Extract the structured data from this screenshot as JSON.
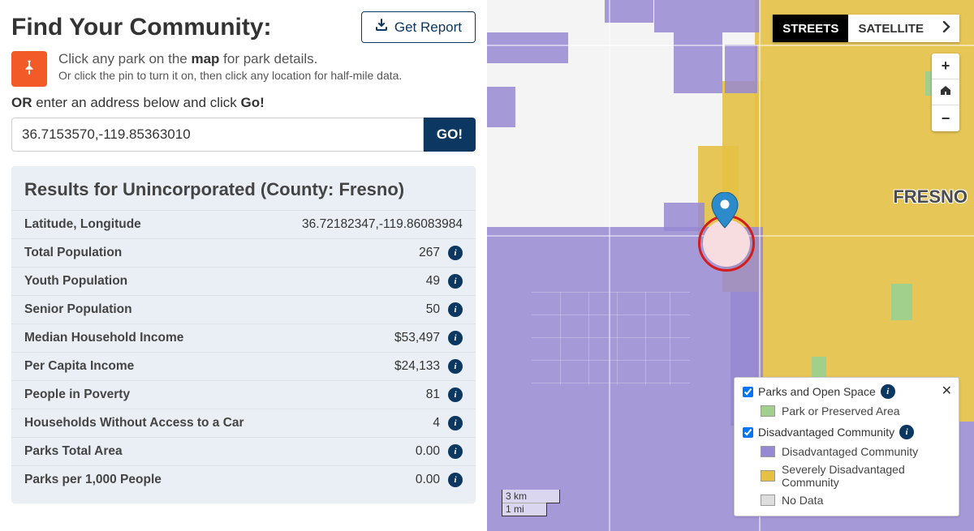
{
  "header": {
    "title": "Find Your Community:",
    "get_report": "Get Report"
  },
  "instructions": {
    "line1_pre": "Click any park on the ",
    "line1_bold": "map",
    "line1_post": " for park details.",
    "line2": "Or click the pin to turn it on, then click any location for half-mile data."
  },
  "or_line": {
    "bold1": "OR",
    "mid": " enter an address below and click ",
    "bold2": "Go!"
  },
  "address": {
    "value": "36.7153570,-119.85363010",
    "go": "GO!"
  },
  "results": {
    "title": "Results for Unincorporated (County: Fresno)",
    "rows": [
      {
        "label": "Latitude, Longitude",
        "value": "36.72182347,-119.86083984",
        "info": false
      },
      {
        "label": "Total Population",
        "value": "267",
        "info": true
      },
      {
        "label": "Youth Population",
        "value": "49",
        "info": true
      },
      {
        "label": "Senior Population",
        "value": "50",
        "info": true
      },
      {
        "label": "Median Household Income",
        "value": "$53,497",
        "info": true
      },
      {
        "label": "Per Capita Income",
        "value": "$24,133",
        "info": true
      },
      {
        "label": "People in Poverty",
        "value": "81",
        "info": true
      },
      {
        "label": "Households Without Access to a Car",
        "value": "4",
        "info": true
      },
      {
        "label": "Parks Total Area",
        "value": "0.00",
        "info": true
      },
      {
        "label": "Parks per 1,000 People",
        "value": "0.00",
        "info": true
      }
    ]
  },
  "map": {
    "streets": "STREETS",
    "satellite": "SATELLITE",
    "fresno": "FRESNO",
    "scale_km": "3 km",
    "scale_mi": "1 mi"
  },
  "legend": {
    "layer1": "Parks and Open Space",
    "item1": "Park or Preserved Area",
    "layer2": "Disadvantaged Community",
    "item2a": "Disadvantaged Community",
    "item2b": "Severely Disadvantaged Community",
    "item2c": "No Data"
  }
}
